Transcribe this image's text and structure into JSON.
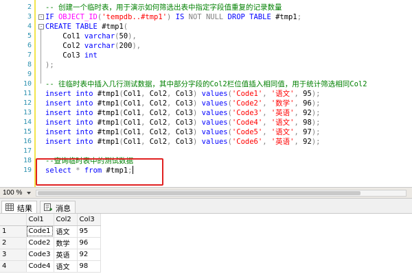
{
  "editor": {
    "lines": [
      {
        "n": "2",
        "fold": "",
        "html_parts": [
          {
            "cls": "cm",
            "t": "-- 创建一个临时表，用于演示如何筛选出表中指定字段值重复的记录数量"
          }
        ]
      },
      {
        "n": "3",
        "fold": "-",
        "html_parts": [
          {
            "cls": "kw",
            "t": "IF "
          },
          {
            "cls": "fn",
            "t": "OBJECT_ID"
          },
          {
            "cls": "gray",
            "t": "("
          },
          {
            "cls": "str",
            "t": "'tempdb..#tmp1'"
          },
          {
            "cls": "gray",
            "t": ")"
          },
          {
            "cls": "kw",
            "t": " IS "
          },
          {
            "cls": "gray",
            "t": "NOT NULL"
          },
          {
            "cls": "kw",
            "t": " DROP TABLE "
          },
          {
            "cls": "",
            "t": "#tmp1"
          },
          {
            "cls": "gray",
            "t": ";"
          }
        ]
      },
      {
        "n": "4",
        "fold": "-",
        "html_parts": [
          {
            "cls": "kw",
            "t": "CREATE TABLE "
          },
          {
            "cls": "",
            "t": "#tmp1"
          },
          {
            "cls": "gray",
            "t": "("
          }
        ]
      },
      {
        "n": "5",
        "fold": "",
        "html_parts": [
          {
            "cls": "",
            "t": "    Col1 "
          },
          {
            "cls": "kw",
            "t": "varchar"
          },
          {
            "cls": "gray",
            "t": "("
          },
          {
            "cls": "",
            "t": "50"
          },
          {
            "cls": "gray",
            "t": "),"
          }
        ]
      },
      {
        "n": "6",
        "fold": "",
        "html_parts": [
          {
            "cls": "",
            "t": "    Col2 "
          },
          {
            "cls": "kw",
            "t": "varchar"
          },
          {
            "cls": "gray",
            "t": "("
          },
          {
            "cls": "",
            "t": "200"
          },
          {
            "cls": "gray",
            "t": "),"
          }
        ]
      },
      {
        "n": "7",
        "fold": "",
        "html_parts": [
          {
            "cls": "",
            "t": "    Col3 "
          },
          {
            "cls": "kw",
            "t": "int"
          }
        ]
      },
      {
        "n": "8",
        "fold": "",
        "html_parts": [
          {
            "cls": "gray",
            "t": ");"
          }
        ]
      },
      {
        "n": "9",
        "fold": "",
        "html_parts": []
      },
      {
        "n": "10",
        "fold": "",
        "html_parts": [
          {
            "cls": "cm",
            "t": "-- 往临时表中插入几行测试数据，其中部分字段的Col2栏位值插入相同值，用于统计筛选相同Col2"
          }
        ]
      },
      {
        "n": "11",
        "fold": "",
        "html_parts": [
          {
            "cls": "kw",
            "t": "insert into "
          },
          {
            "cls": "",
            "t": "#tmp1"
          },
          {
            "cls": "gray",
            "t": "("
          },
          {
            "cls": "",
            "t": "Col1"
          },
          {
            "cls": "gray",
            "t": ", "
          },
          {
            "cls": "",
            "t": "Col2"
          },
          {
            "cls": "gray",
            "t": ", "
          },
          {
            "cls": "",
            "t": "Col3"
          },
          {
            "cls": "gray",
            "t": ") "
          },
          {
            "cls": "kw",
            "t": "values"
          },
          {
            "cls": "gray",
            "t": "("
          },
          {
            "cls": "str",
            "t": "'Code1'"
          },
          {
            "cls": "gray",
            "t": ", "
          },
          {
            "cls": "str",
            "t": "'语文'"
          },
          {
            "cls": "gray",
            "t": ", "
          },
          {
            "cls": "",
            "t": "95"
          },
          {
            "cls": "gray",
            "t": ");"
          }
        ]
      },
      {
        "n": "12",
        "fold": "",
        "html_parts": [
          {
            "cls": "kw",
            "t": "insert into "
          },
          {
            "cls": "",
            "t": "#tmp1"
          },
          {
            "cls": "gray",
            "t": "("
          },
          {
            "cls": "",
            "t": "Col1"
          },
          {
            "cls": "gray",
            "t": ", "
          },
          {
            "cls": "",
            "t": "Col2"
          },
          {
            "cls": "gray",
            "t": ", "
          },
          {
            "cls": "",
            "t": "Col3"
          },
          {
            "cls": "gray",
            "t": ") "
          },
          {
            "cls": "kw",
            "t": "values"
          },
          {
            "cls": "gray",
            "t": "("
          },
          {
            "cls": "str",
            "t": "'Code2'"
          },
          {
            "cls": "gray",
            "t": ", "
          },
          {
            "cls": "str",
            "t": "'数学'"
          },
          {
            "cls": "gray",
            "t": ", "
          },
          {
            "cls": "",
            "t": "96"
          },
          {
            "cls": "gray",
            "t": ");"
          }
        ]
      },
      {
        "n": "13",
        "fold": "",
        "html_parts": [
          {
            "cls": "kw",
            "t": "insert into "
          },
          {
            "cls": "",
            "t": "#tmp1"
          },
          {
            "cls": "gray",
            "t": "("
          },
          {
            "cls": "",
            "t": "Col1"
          },
          {
            "cls": "gray",
            "t": ", "
          },
          {
            "cls": "",
            "t": "Col2"
          },
          {
            "cls": "gray",
            "t": ", "
          },
          {
            "cls": "",
            "t": "Col3"
          },
          {
            "cls": "gray",
            "t": ") "
          },
          {
            "cls": "kw",
            "t": "values"
          },
          {
            "cls": "gray",
            "t": "("
          },
          {
            "cls": "str",
            "t": "'Code3'"
          },
          {
            "cls": "gray",
            "t": ", "
          },
          {
            "cls": "str",
            "t": "'英语'"
          },
          {
            "cls": "gray",
            "t": ", "
          },
          {
            "cls": "",
            "t": "92"
          },
          {
            "cls": "gray",
            "t": ");"
          }
        ]
      },
      {
        "n": "14",
        "fold": "",
        "html_parts": [
          {
            "cls": "kw",
            "t": "insert into "
          },
          {
            "cls": "",
            "t": "#tmp1"
          },
          {
            "cls": "gray",
            "t": "("
          },
          {
            "cls": "",
            "t": "Col1"
          },
          {
            "cls": "gray",
            "t": ", "
          },
          {
            "cls": "",
            "t": "Col2"
          },
          {
            "cls": "gray",
            "t": ", "
          },
          {
            "cls": "",
            "t": "Col3"
          },
          {
            "cls": "gray",
            "t": ") "
          },
          {
            "cls": "kw",
            "t": "values"
          },
          {
            "cls": "gray",
            "t": "("
          },
          {
            "cls": "str",
            "t": "'Code4'"
          },
          {
            "cls": "gray",
            "t": ", "
          },
          {
            "cls": "str",
            "t": "'语文'"
          },
          {
            "cls": "gray",
            "t": ", "
          },
          {
            "cls": "",
            "t": "98"
          },
          {
            "cls": "gray",
            "t": ");"
          }
        ]
      },
      {
        "n": "15",
        "fold": "",
        "html_parts": [
          {
            "cls": "kw",
            "t": "insert into "
          },
          {
            "cls": "",
            "t": "#tmp1"
          },
          {
            "cls": "gray",
            "t": "("
          },
          {
            "cls": "",
            "t": "Col1"
          },
          {
            "cls": "gray",
            "t": ", "
          },
          {
            "cls": "",
            "t": "Col2"
          },
          {
            "cls": "gray",
            "t": ", "
          },
          {
            "cls": "",
            "t": "Col3"
          },
          {
            "cls": "gray",
            "t": ") "
          },
          {
            "cls": "kw",
            "t": "values"
          },
          {
            "cls": "gray",
            "t": "("
          },
          {
            "cls": "str",
            "t": "'Code5'"
          },
          {
            "cls": "gray",
            "t": ", "
          },
          {
            "cls": "str",
            "t": "'语文'"
          },
          {
            "cls": "gray",
            "t": ", "
          },
          {
            "cls": "",
            "t": "97"
          },
          {
            "cls": "gray",
            "t": ");"
          }
        ]
      },
      {
        "n": "16",
        "fold": "",
        "html_parts": [
          {
            "cls": "kw",
            "t": "insert into "
          },
          {
            "cls": "",
            "t": "#tmp1"
          },
          {
            "cls": "gray",
            "t": "("
          },
          {
            "cls": "",
            "t": "Col1"
          },
          {
            "cls": "gray",
            "t": ", "
          },
          {
            "cls": "",
            "t": "Col2"
          },
          {
            "cls": "gray",
            "t": ", "
          },
          {
            "cls": "",
            "t": "Col3"
          },
          {
            "cls": "gray",
            "t": ") "
          },
          {
            "cls": "kw",
            "t": "values"
          },
          {
            "cls": "gray",
            "t": "("
          },
          {
            "cls": "str",
            "t": "'Code6'"
          },
          {
            "cls": "gray",
            "t": ", "
          },
          {
            "cls": "str",
            "t": "'英语'"
          },
          {
            "cls": "gray",
            "t": ", "
          },
          {
            "cls": "",
            "t": "92"
          },
          {
            "cls": "gray",
            "t": ");"
          }
        ]
      },
      {
        "n": "17",
        "fold": "",
        "html_parts": []
      },
      {
        "n": "18",
        "fold": "",
        "html_parts": [
          {
            "cls": "cm",
            "t": "--查询临时表中的测试数据"
          }
        ]
      },
      {
        "n": "19",
        "fold": "",
        "html_parts": [
          {
            "cls": "kw",
            "t": "select "
          },
          {
            "cls": "gray",
            "t": "* "
          },
          {
            "cls": "kw",
            "t": "from "
          },
          {
            "cls": "",
            "t": "#tmp1"
          },
          {
            "cls": "gray",
            "t": ";"
          }
        ]
      }
    ]
  },
  "zoom": {
    "label": "100 %"
  },
  "tabs": [
    {
      "label": "结果",
      "icon": "grid-icon",
      "active": true
    },
    {
      "label": "消息",
      "icon": "message-icon",
      "active": false
    }
  ],
  "results": {
    "columns": [
      "Col1",
      "Col2",
      "Col3"
    ],
    "rows": [
      {
        "num": "1",
        "cells": [
          "Code1",
          "语文",
          "95"
        ]
      },
      {
        "num": "2",
        "cells": [
          "Code2",
          "数学",
          "96"
        ]
      },
      {
        "num": "3",
        "cells": [
          "Code3",
          "英语",
          "92"
        ]
      },
      {
        "num": "4",
        "cells": [
          "Code4",
          "语文",
          "98"
        ]
      }
    ]
  },
  "colors": {
    "keyword": "#0000ff",
    "string": "#ff0000",
    "comment": "#008000",
    "function": "#ff00ff",
    "highlight_box": "#e02020"
  }
}
